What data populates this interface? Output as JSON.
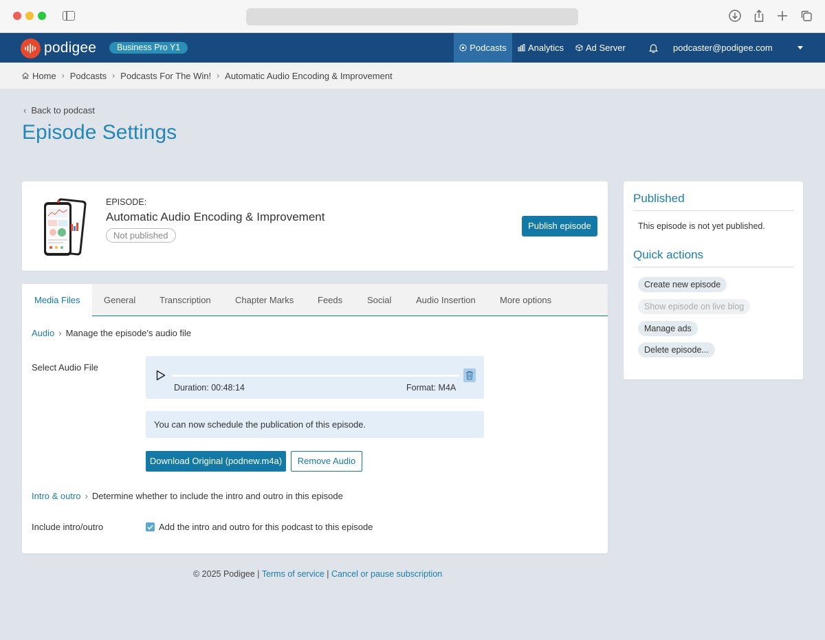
{
  "app": {
    "brand": "podigee",
    "plan_badge": "Business Pro Y1",
    "nav": {
      "podcasts": "Podcasts",
      "analytics": "Analytics",
      "ad_server": "Ad Server",
      "user_email": "podcaster@podigee.com"
    },
    "colors": {
      "header": "#174a7e",
      "accent": "#137aa7",
      "brand": "#e7492c"
    }
  },
  "breadcrumb": [
    "Home",
    "Podcasts",
    "Podcasts For The Win!",
    "Automatic Audio Encoding & Improvement"
  ],
  "page": {
    "back_label": "Back to podcast",
    "title": "Episode Settings"
  },
  "episode": {
    "label": "EPISODE:",
    "title": "Automatic Audio Encoding & Improvement",
    "status": "Not published",
    "publish_button": "Publish episode"
  },
  "tabs": [
    "Media Files",
    "General",
    "Transcription",
    "Chapter Marks",
    "Feeds",
    "Social",
    "Audio Insertion",
    "More options"
  ],
  "audio_section": {
    "link": "Audio",
    "description": "Manage the episode's audio file",
    "field_label": "Select Audio File",
    "duration": "Duration: 00:48:14",
    "format": "Format: M4A",
    "progress": 0,
    "notice": "You can now schedule the publication of this episode.",
    "download_button": "Download Original (podnew.m4a)",
    "remove_button": "Remove Audio"
  },
  "intro_section": {
    "link": "Intro & outro",
    "description": "Determine whether to include the intro and outro in this episode",
    "field_label": "Include intro/outro",
    "checkbox_label": "Add the intro and outro for this podcast to this episode",
    "checked": true
  },
  "sidebar": {
    "published_heading": "Published",
    "published_text": "This episode is not yet published.",
    "quick_heading": "Quick actions",
    "quick_actions": [
      {
        "label": "Create new episode",
        "enabled": true
      },
      {
        "label": "Show episode on live blog",
        "enabled": false
      },
      {
        "label": "Manage ads",
        "enabled": true
      },
      {
        "label": "Delete episode...",
        "enabled": true
      }
    ]
  },
  "footer": {
    "copyright": "© 2025 Podigee |",
    "terms": "Terms of service",
    "divider": "|",
    "cancel": "Cancel or pause subscription"
  }
}
